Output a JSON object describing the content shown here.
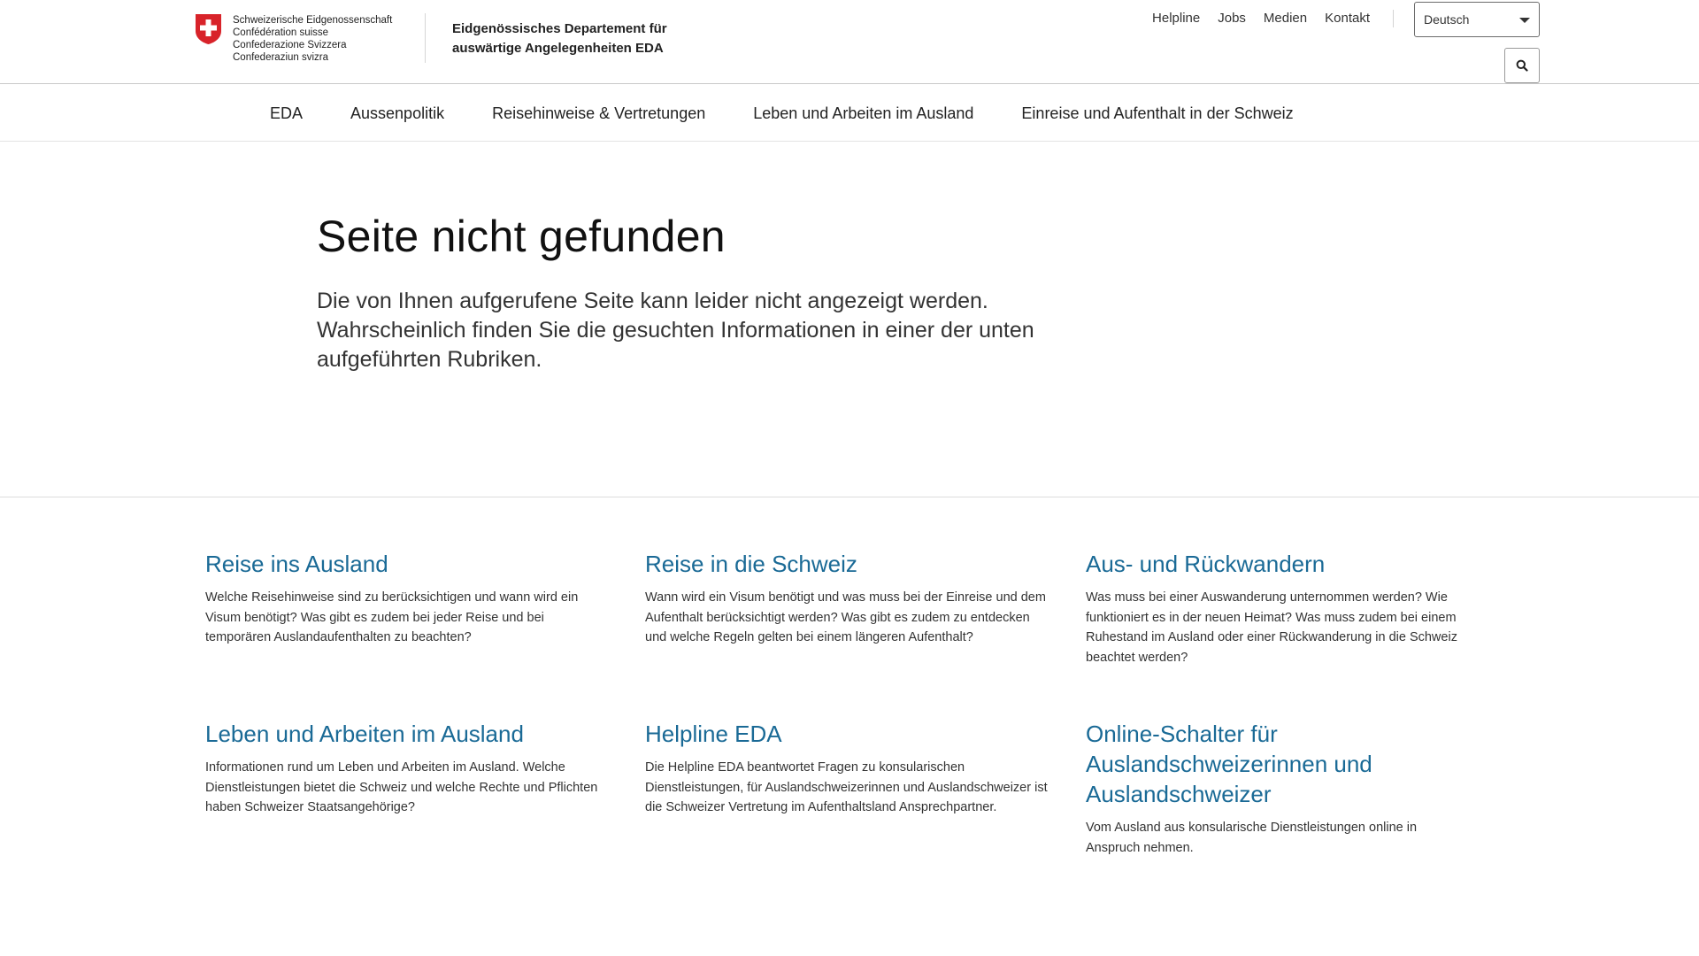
{
  "header": {
    "logo_lines": [
      "Schweizerische Eidgenossenschaft",
      "Confédération suisse",
      "Confederazione Svizzera",
      "Confederaziun svizra"
    ],
    "department_line1": "Eidgenössisches Departement für",
    "department_line2": "auswärtige Angelegenheiten EDA",
    "meta_nav": [
      "Helpline",
      "Jobs",
      "Medien",
      "Kontakt"
    ],
    "language": "Deutsch",
    "search_icon": "search-icon"
  },
  "main_nav": [
    "EDA",
    "Aussenpolitik",
    "Reisehinweise & Vertretungen",
    "Leben und Arbeiten im Ausland",
    "Einreise und Aufenthalt in der Schweiz"
  ],
  "hero": {
    "title": "Seite nicht gefunden",
    "text": "Die von Ihnen aufgerufene Seite kann leider nicht angezeigt werden. Wahrscheinlich finden Sie die gesuchten Informationen in einer der unten aufgeführten Rubriken."
  },
  "teasers": [
    {
      "title": "Reise ins Ausland",
      "text": "Welche Reisehinweise sind zu berücksichtigen und wann wird ein Visum benötigt? Was gibt es zudem bei jeder Reise und bei temporären Auslandaufenthalten zu beachten?"
    },
    {
      "title": "Reise in die Schweiz",
      "text": "Wann wird ein Visum benötigt und was muss bei der Einreise und dem Aufenthalt berücksichtigt werden? Was gibt es zudem zu entdecken und welche Regeln gelten bei einem längeren Aufenthalt?"
    },
    {
      "title": "Aus- und Rückwandern",
      "text": "Was muss bei einer Auswanderung unternommen werden? Wie funktioniert es in der neuen Heimat? Was muss zudem bei einem Ruhestand im Ausland oder einer Rückwanderung in die Schweiz beachtet werden?"
    },
    {
      "title": "Leben und Arbeiten im Ausland",
      "text": "Informationen rund um Leben und Arbeiten im Ausland. Welche Dienstleistungen bietet die Schweiz und welche Rechte und Pflichten haben Schweizer Staatsangehörige?"
    },
    {
      "title": "Helpline EDA",
      "text": "Die Helpline EDA beantwortet Fragen zu konsularischen Dienstleistungen, für Auslandschweizerinnen und Auslandschweizer ist die Schweizer Vertretung im Aufenthaltsland Ansprechpartner."
    },
    {
      "title": "Online-Schalter für Auslandschweizerinnen und Auslandschweizer",
      "text": "Vom Ausland aus konsularische Dienstleistungen online in Anspruch nehmen."
    }
  ],
  "colors": {
    "flag_red": "#d8232a",
    "link_blue": "#1a6a96"
  }
}
